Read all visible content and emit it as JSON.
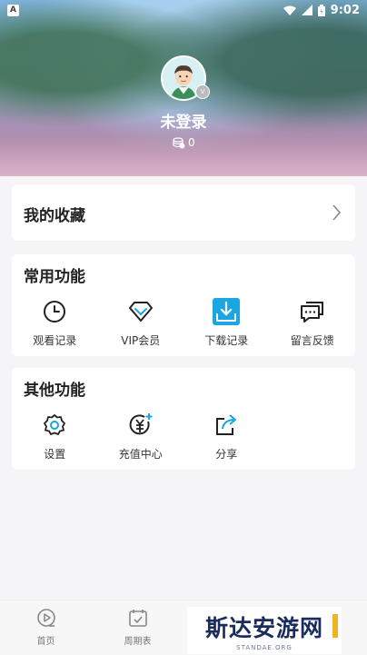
{
  "statusbar": {
    "time": "9:02",
    "left_badge": "A"
  },
  "profile": {
    "username": "未登录",
    "coins": "0",
    "avatar_badge": "V"
  },
  "favorites": {
    "title": "我的收藏"
  },
  "common": {
    "title": "常用功能",
    "items": [
      {
        "label": "观看记录",
        "icon": "clock-icon"
      },
      {
        "label": "VIP会员",
        "icon": "diamond-icon"
      },
      {
        "label": "下载记录",
        "icon": "download-icon"
      },
      {
        "label": "留言反馈",
        "icon": "chat-icon"
      }
    ]
  },
  "other": {
    "title": "其他功能",
    "items": [
      {
        "label": "设置",
        "icon": "gear-icon"
      },
      {
        "label": "充值中心",
        "icon": "yuan-recharge-icon"
      },
      {
        "label": "分享",
        "icon": "share-icon"
      }
    ]
  },
  "nav": {
    "items": [
      {
        "label": "首页",
        "icon": "play-home-icon"
      },
      {
        "label": "周期表",
        "icon": "calendar-icon"
      }
    ]
  },
  "watermark": {
    "text": "斯达安游网",
    "sub": "STANDAE.ORG"
  },
  "colors": {
    "accent": "#1aa6e0",
    "icon_dark": "#333333"
  }
}
